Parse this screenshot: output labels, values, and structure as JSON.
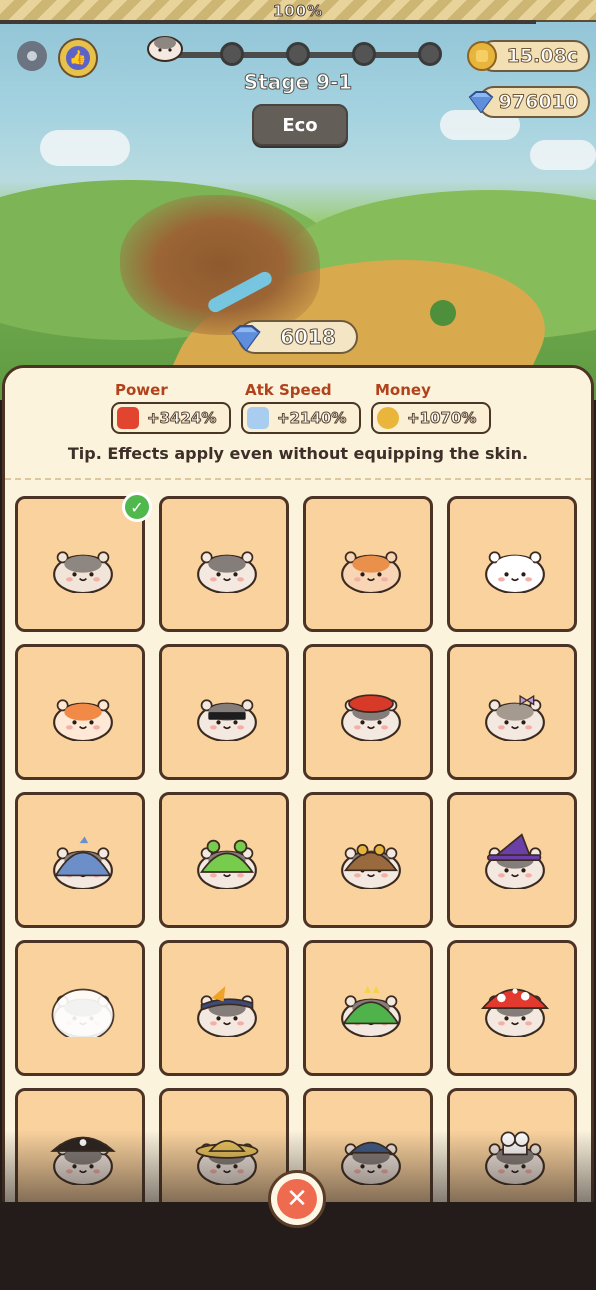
{
  "top_progress": {
    "label": "100%",
    "value_percent": 100
  },
  "header": {
    "stage_title": "Stage 9-1",
    "eco_button": "Eco",
    "settings_icon": "gear-icon",
    "like_icon": "thumbs-up-icon"
  },
  "currency": {
    "coins": "15.08c",
    "gems": "976010"
  },
  "skin_gem_cost": "6018",
  "stats": {
    "power_label": "Power",
    "power_value": "+3424%",
    "atk_speed_label": "Atk Speed",
    "atk_speed_value": "+2140%",
    "money_label": "Money",
    "money_value": "+1070%"
  },
  "tip": "Tip. Effects apply even without equipping the skin.",
  "skins": [
    {
      "name": "classic",
      "fur": "#f1e4d8",
      "patch": "#8e8680",
      "hat": "none",
      "equipped": true
    },
    {
      "name": "grey",
      "fur": "#f3e9e0",
      "patch": "#847d79",
      "hat": "none"
    },
    {
      "name": "ginger",
      "fur": "#f7d5b5",
      "patch": "#e9904a",
      "hat": "none"
    },
    {
      "name": "white",
      "fur": "#ffffff",
      "patch": "#ffffff",
      "hat": "none"
    },
    {
      "name": "orange",
      "fur": "#ffe8d6",
      "patch": "#f08a46",
      "hat": "none"
    },
    {
      "name": "sunglasses",
      "fur": "#f3e9e0",
      "patch": "#847d79",
      "hat": "sunglasses"
    },
    {
      "name": "beret",
      "fur": "#f3e9e0",
      "patch": "#847d79",
      "hat": "beret"
    },
    {
      "name": "bow",
      "fur": "#f3e9e0",
      "patch": "#a59a90",
      "hat": "bow"
    },
    {
      "name": "shark",
      "fur": "#f3e9e0",
      "patch": "#847d79",
      "hat": "shark"
    },
    {
      "name": "frog",
      "fur": "#f3e9e0",
      "patch": "#847d79",
      "hat": "frog"
    },
    {
      "name": "aviator",
      "fur": "#f3e9e0",
      "patch": "#847d79",
      "hat": "aviator"
    },
    {
      "name": "witch",
      "fur": "#f3e9e0",
      "patch": "#847d79",
      "hat": "witch"
    },
    {
      "name": "astronaut",
      "fur": "#f3e9e0",
      "patch": "#847d79",
      "hat": "astronaut"
    },
    {
      "name": "ninja",
      "fur": "#f3e9e0",
      "patch": "#847d79",
      "hat": "ninja"
    },
    {
      "name": "dino",
      "fur": "#f3e9e0",
      "patch": "#847d79",
      "hat": "dino"
    },
    {
      "name": "mushroom",
      "fur": "#f3e9e0",
      "patch": "#847d79",
      "hat": "mushroom"
    },
    {
      "name": "pirate",
      "fur": "#f3e9e0",
      "patch": "#847d79",
      "hat": "pirate"
    },
    {
      "name": "straw-hat",
      "fur": "#f3e9e0",
      "patch": "#847d79",
      "hat": "straw"
    },
    {
      "name": "cap",
      "fur": "#f3e9e0",
      "patch": "#847d79",
      "hat": "cap"
    },
    {
      "name": "chef",
      "fur": "#f3e9e0",
      "patch": "#847d79",
      "hat": "chef"
    }
  ],
  "close_icon": "close-x-icon",
  "colors": {
    "panel_bg": "#fcf3dd",
    "cell_bg": "#f9d29e",
    "stat_label": "#b0431c",
    "close_red": "#ef6b4f",
    "check_green": "#51b84d"
  }
}
